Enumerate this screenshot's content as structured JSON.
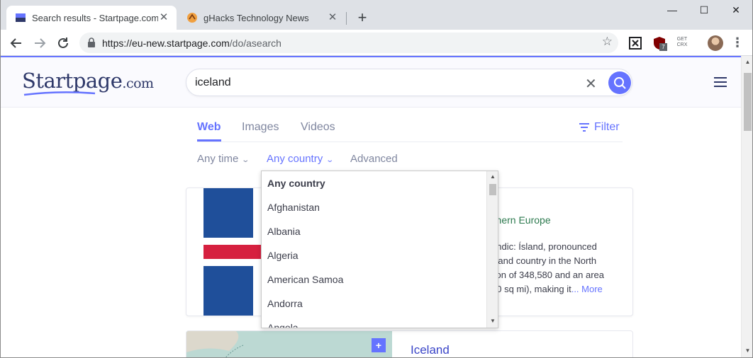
{
  "browser": {
    "tabs": [
      {
        "title": "Search results - Startpage.com",
        "close": "✕"
      },
      {
        "title": "gHacks Technology News",
        "close": "✕"
      }
    ],
    "new_tab": "+",
    "window_controls": {
      "minimize": "—",
      "maximize": "☐",
      "close": "✕"
    },
    "url_host": "https://eu-new.startpage.com",
    "url_path": "/do/asearch",
    "extensions": [
      {
        "icon": "screenshot-extension-icon"
      },
      {
        "icon": "ublock-origin-icon",
        "badge": "7"
      },
      {
        "icon": "get-crx-icon",
        "line1": "GET",
        "line2": "CRX"
      }
    ],
    "menu": "⋮"
  },
  "site": {
    "logo_main": "Startpage",
    "logo_suffix": ".com",
    "search_query": "iceland",
    "clear_symbol": "✕",
    "accent_color": "#6573ff"
  },
  "search_tabs": {
    "web": "Web",
    "images": "Images",
    "videos": "Videos",
    "filter": "Filter"
  },
  "filters": {
    "any_time": "Any time",
    "any_country": "Any country",
    "advanced": "Advanced"
  },
  "country_dropdown": {
    "items": [
      "Any country",
      "Afghanistan",
      "Albania",
      "Algeria",
      "American Samoa",
      "Andorra",
      "Angola"
    ],
    "selected_index": 0
  },
  "result_card": {
    "region": "rthern Europe",
    "desc_line1": "andic: Ísland, pronounced",
    "desc_line2": "sland country in the North",
    "desc_line3": "tion of 348,580 and an area",
    "desc_line4": "00 sq mi), making it",
    "more": "... More"
  },
  "result_card_2": {
    "title": "Iceland",
    "zoom_in": "+"
  }
}
